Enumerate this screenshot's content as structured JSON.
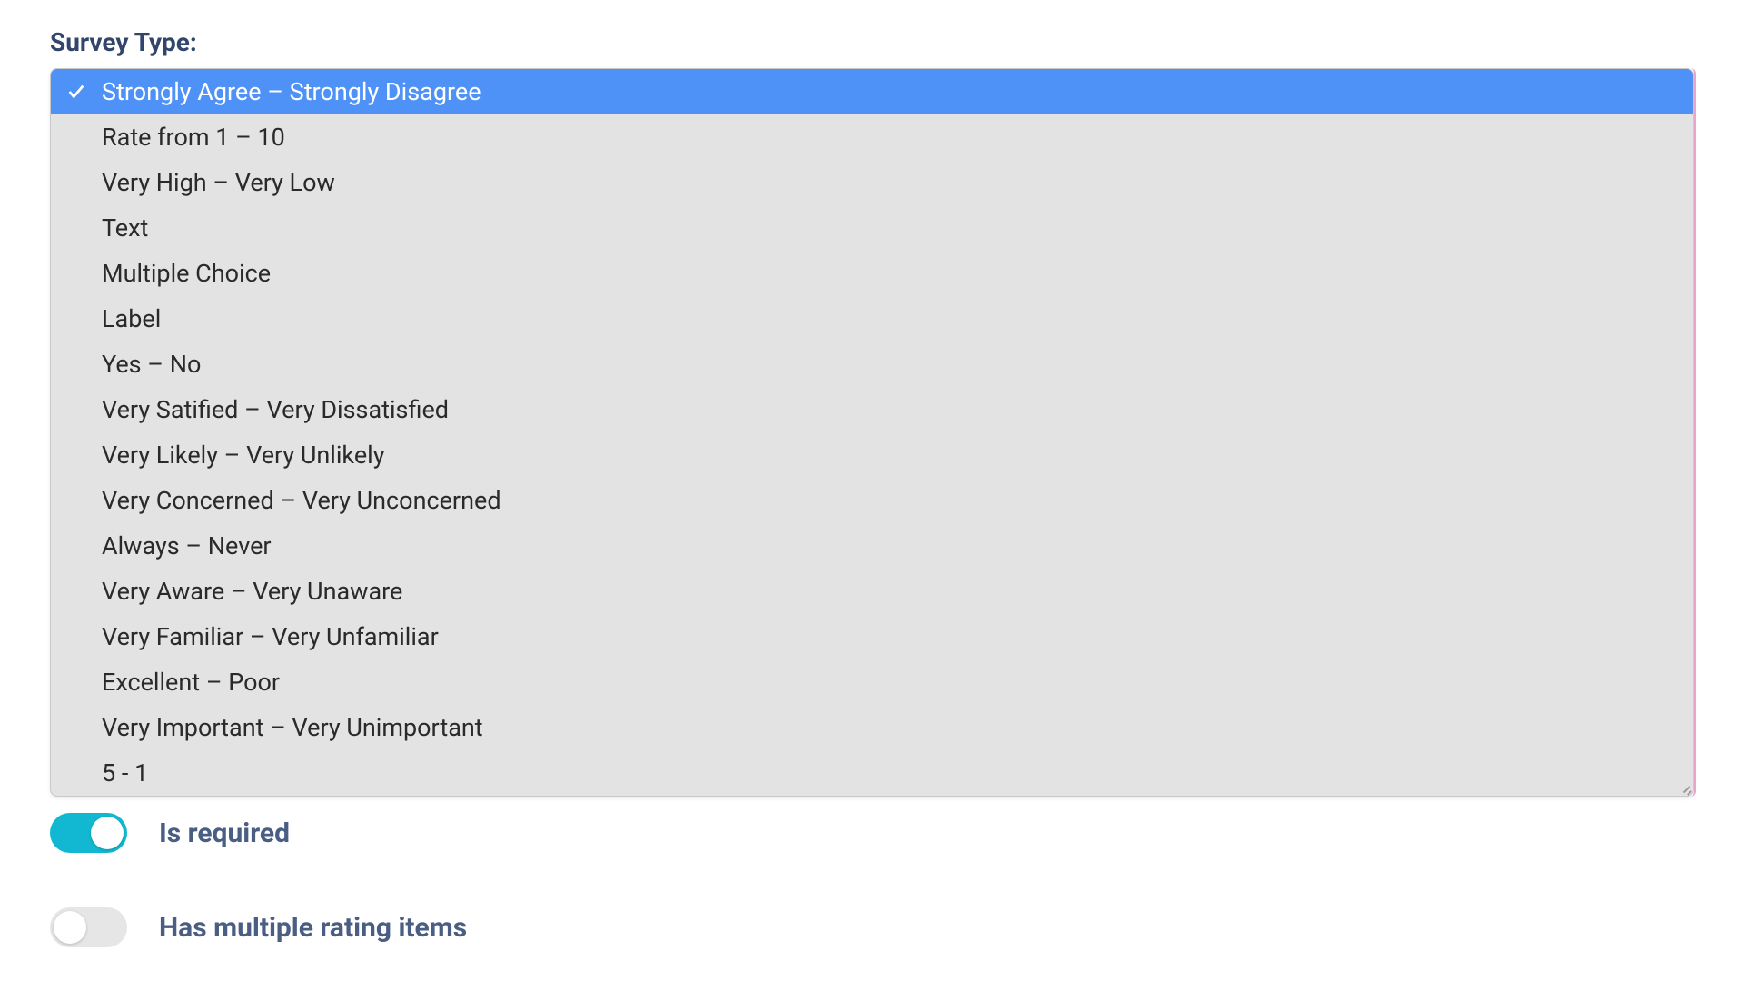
{
  "field": {
    "label": "Survey Type:"
  },
  "dropdown": {
    "selected_index": 0,
    "options": [
      "Strongly Agree – Strongly Disagree",
      "Rate from 1 – 10",
      "Very High – Very Low",
      "Text",
      "Multiple Choice",
      "Label",
      "Yes – No",
      "Very Satified – Very Dissatisfied",
      "Very Likely – Very Unlikely",
      "Very Concerned – Very Unconcerned",
      "Always – Never",
      "Very Aware – Very Unaware",
      "Very Familiar – Very Unfamiliar",
      "Excellent – Poor",
      "Very Important – Very Unimportant",
      "5 - 1"
    ]
  },
  "toggles": {
    "required": {
      "label": "Is required",
      "on": true
    },
    "multi": {
      "label": "Has multiple rating items",
      "on": false
    }
  },
  "colors": {
    "accent_toggle": "#12b8d1",
    "dropdown_selected": "#4f92f7",
    "label_text": "#32456b",
    "focus_border": "#e36da8"
  }
}
